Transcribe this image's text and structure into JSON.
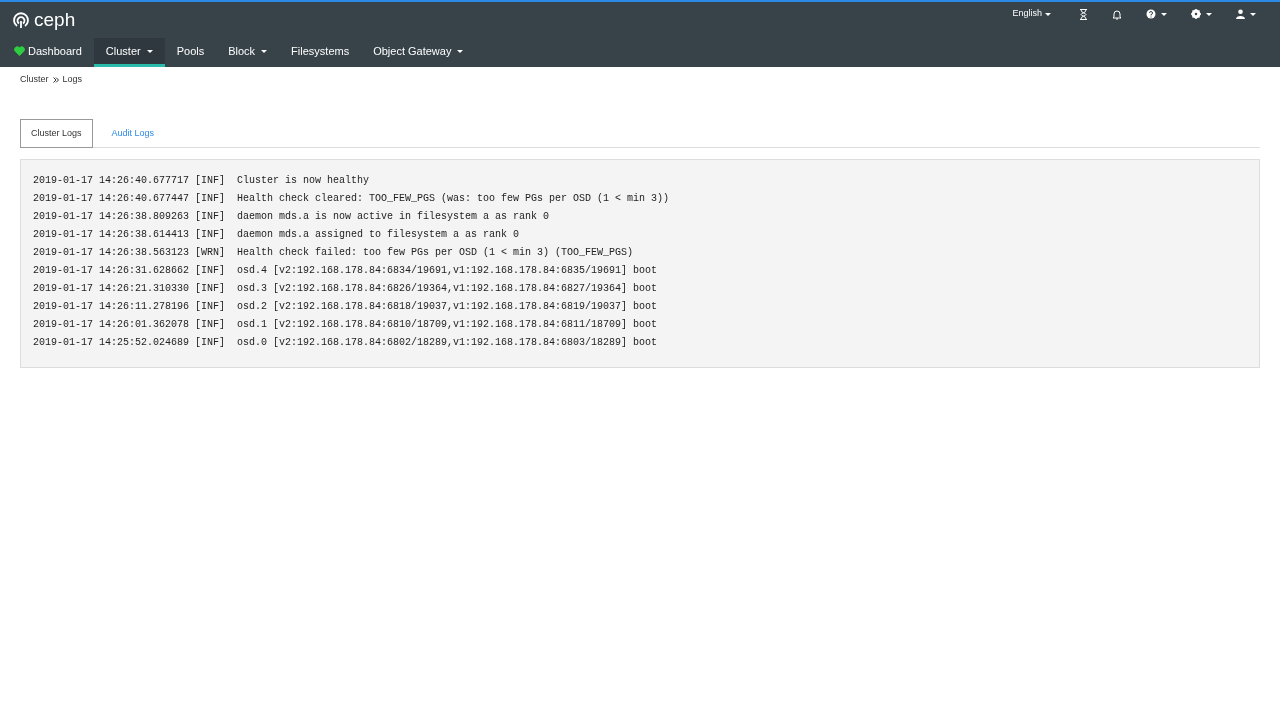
{
  "brand": {
    "name": "ceph"
  },
  "top_menu": {
    "language": "English"
  },
  "nav_items": [
    {
      "label": "Dashboard",
      "selected": false,
      "dropdown": false,
      "kind": "health"
    },
    {
      "label": "Cluster",
      "selected": true,
      "dropdown": true,
      "kind": "plain"
    },
    {
      "label": "Pools",
      "selected": false,
      "dropdown": false,
      "kind": "plain"
    },
    {
      "label": "Block",
      "selected": false,
      "dropdown": true,
      "kind": "plain"
    },
    {
      "label": "Filesystems",
      "selected": false,
      "dropdown": false,
      "kind": "plain"
    },
    {
      "label": "Object Gateway",
      "selected": false,
      "dropdown": true,
      "kind": "plain"
    }
  ],
  "breadcrumb": [
    "Cluster",
    "Logs"
  ],
  "tabs": [
    {
      "label": "Cluster Logs",
      "selected": true
    },
    {
      "label": "Audit Logs",
      "selected": false
    }
  ],
  "log_entries": [
    {
      "timestamp": "2019-01-17 14:26:40.677717",
      "priority": "[INF]",
      "message": "Cluster is now healthy"
    },
    {
      "timestamp": "2019-01-17 14:26:40.677447",
      "priority": "[INF]",
      "message": "Health check cleared: TOO_FEW_PGS (was: too few PGs per OSD (1 < min 3))"
    },
    {
      "timestamp": "2019-01-17 14:26:38.809263",
      "priority": "[INF]",
      "message": "daemon mds.a is now active in filesystem a as rank 0"
    },
    {
      "timestamp": "2019-01-17 14:26:38.614413",
      "priority": "[INF]",
      "message": "daemon mds.a assigned to filesystem a as rank 0"
    },
    {
      "timestamp": "2019-01-17 14:26:38.563123",
      "priority": "[WRN]",
      "message": "Health check failed: too few PGs per OSD (1 < min 3) (TOO_FEW_PGS)"
    },
    {
      "timestamp": "2019-01-17 14:26:31.628662",
      "priority": "[INF]",
      "message": "osd.4 [v2:192.168.178.84:6834/19691,v1:192.168.178.84:6835/19691] boot"
    },
    {
      "timestamp": "2019-01-17 14:26:21.310330",
      "priority": "[INF]",
      "message": "osd.3 [v2:192.168.178.84:6826/19364,v1:192.168.178.84:6827/19364] boot"
    },
    {
      "timestamp": "2019-01-17 14:26:11.278196",
      "priority": "[INF]",
      "message": "osd.2 [v2:192.168.178.84:6818/19037,v1:192.168.178.84:6819/19037] boot"
    },
    {
      "timestamp": "2019-01-17 14:26:01.362078",
      "priority": "[INF]",
      "message": "osd.1 [v2:192.168.178.84:6810/18709,v1:192.168.178.84:6811/18709] boot"
    },
    {
      "timestamp": "2019-01-17 14:25:52.024689",
      "priority": "[INF]",
      "message": "osd.0 [v2:192.168.178.84:6802/18289,v1:192.168.178.84:6803/18289] boot"
    }
  ]
}
